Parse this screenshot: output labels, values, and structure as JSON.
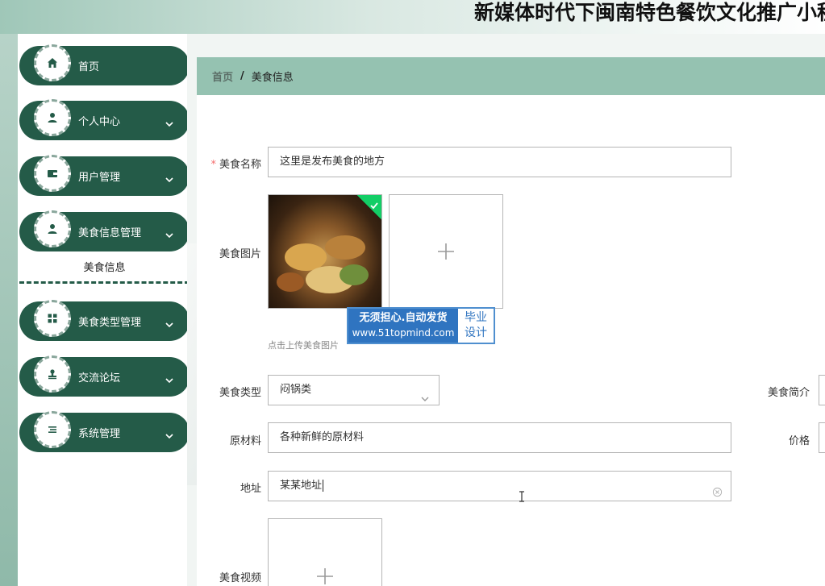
{
  "app": {
    "title": "新媒体时代下闽南特色餐饮文化推广小程序"
  },
  "sidebar": {
    "items": [
      {
        "label": "首页",
        "icon": "home-icon"
      },
      {
        "label": "个人中心",
        "icon": "user-icon"
      },
      {
        "label": "用户管理",
        "icon": "wallet-icon"
      },
      {
        "label": "美食信息管理",
        "icon": "user-icon"
      },
      {
        "label": "美食类型管理",
        "icon": "grid-icon"
      },
      {
        "label": "交流论坛",
        "icon": "stamp-icon"
      },
      {
        "label": "系统管理",
        "icon": "list-icon"
      }
    ],
    "active_sub": "美食信息"
  },
  "breadcrumb": {
    "home": "首页",
    "separator": "/",
    "current": "美食信息"
  },
  "form": {
    "name": {
      "label": "美食名称",
      "required_mark": "*",
      "value": "这里是发布美食的地方"
    },
    "image": {
      "label": "美食图片",
      "hint": "点击上传美食图片"
    },
    "type": {
      "label": "美食类型",
      "value": "闷锅类"
    },
    "intro": {
      "label": "美食简介"
    },
    "material": {
      "label": "原材料",
      "value": "各种新鲜的原材料"
    },
    "price": {
      "label": "价格"
    },
    "address": {
      "label": "地址",
      "value": "某某地址"
    },
    "video": {
      "label": "美食视频"
    }
  },
  "watermark": {
    "line1": "无须担心.自动发货",
    "line2": "www.51topmind.com",
    "right1": "毕业",
    "right2": "设计"
  },
  "colors": {
    "primary": "#245b48",
    "breadcrumb_bg": "#95c2b1",
    "success": "#13ce66",
    "required": "#f56c6c"
  }
}
